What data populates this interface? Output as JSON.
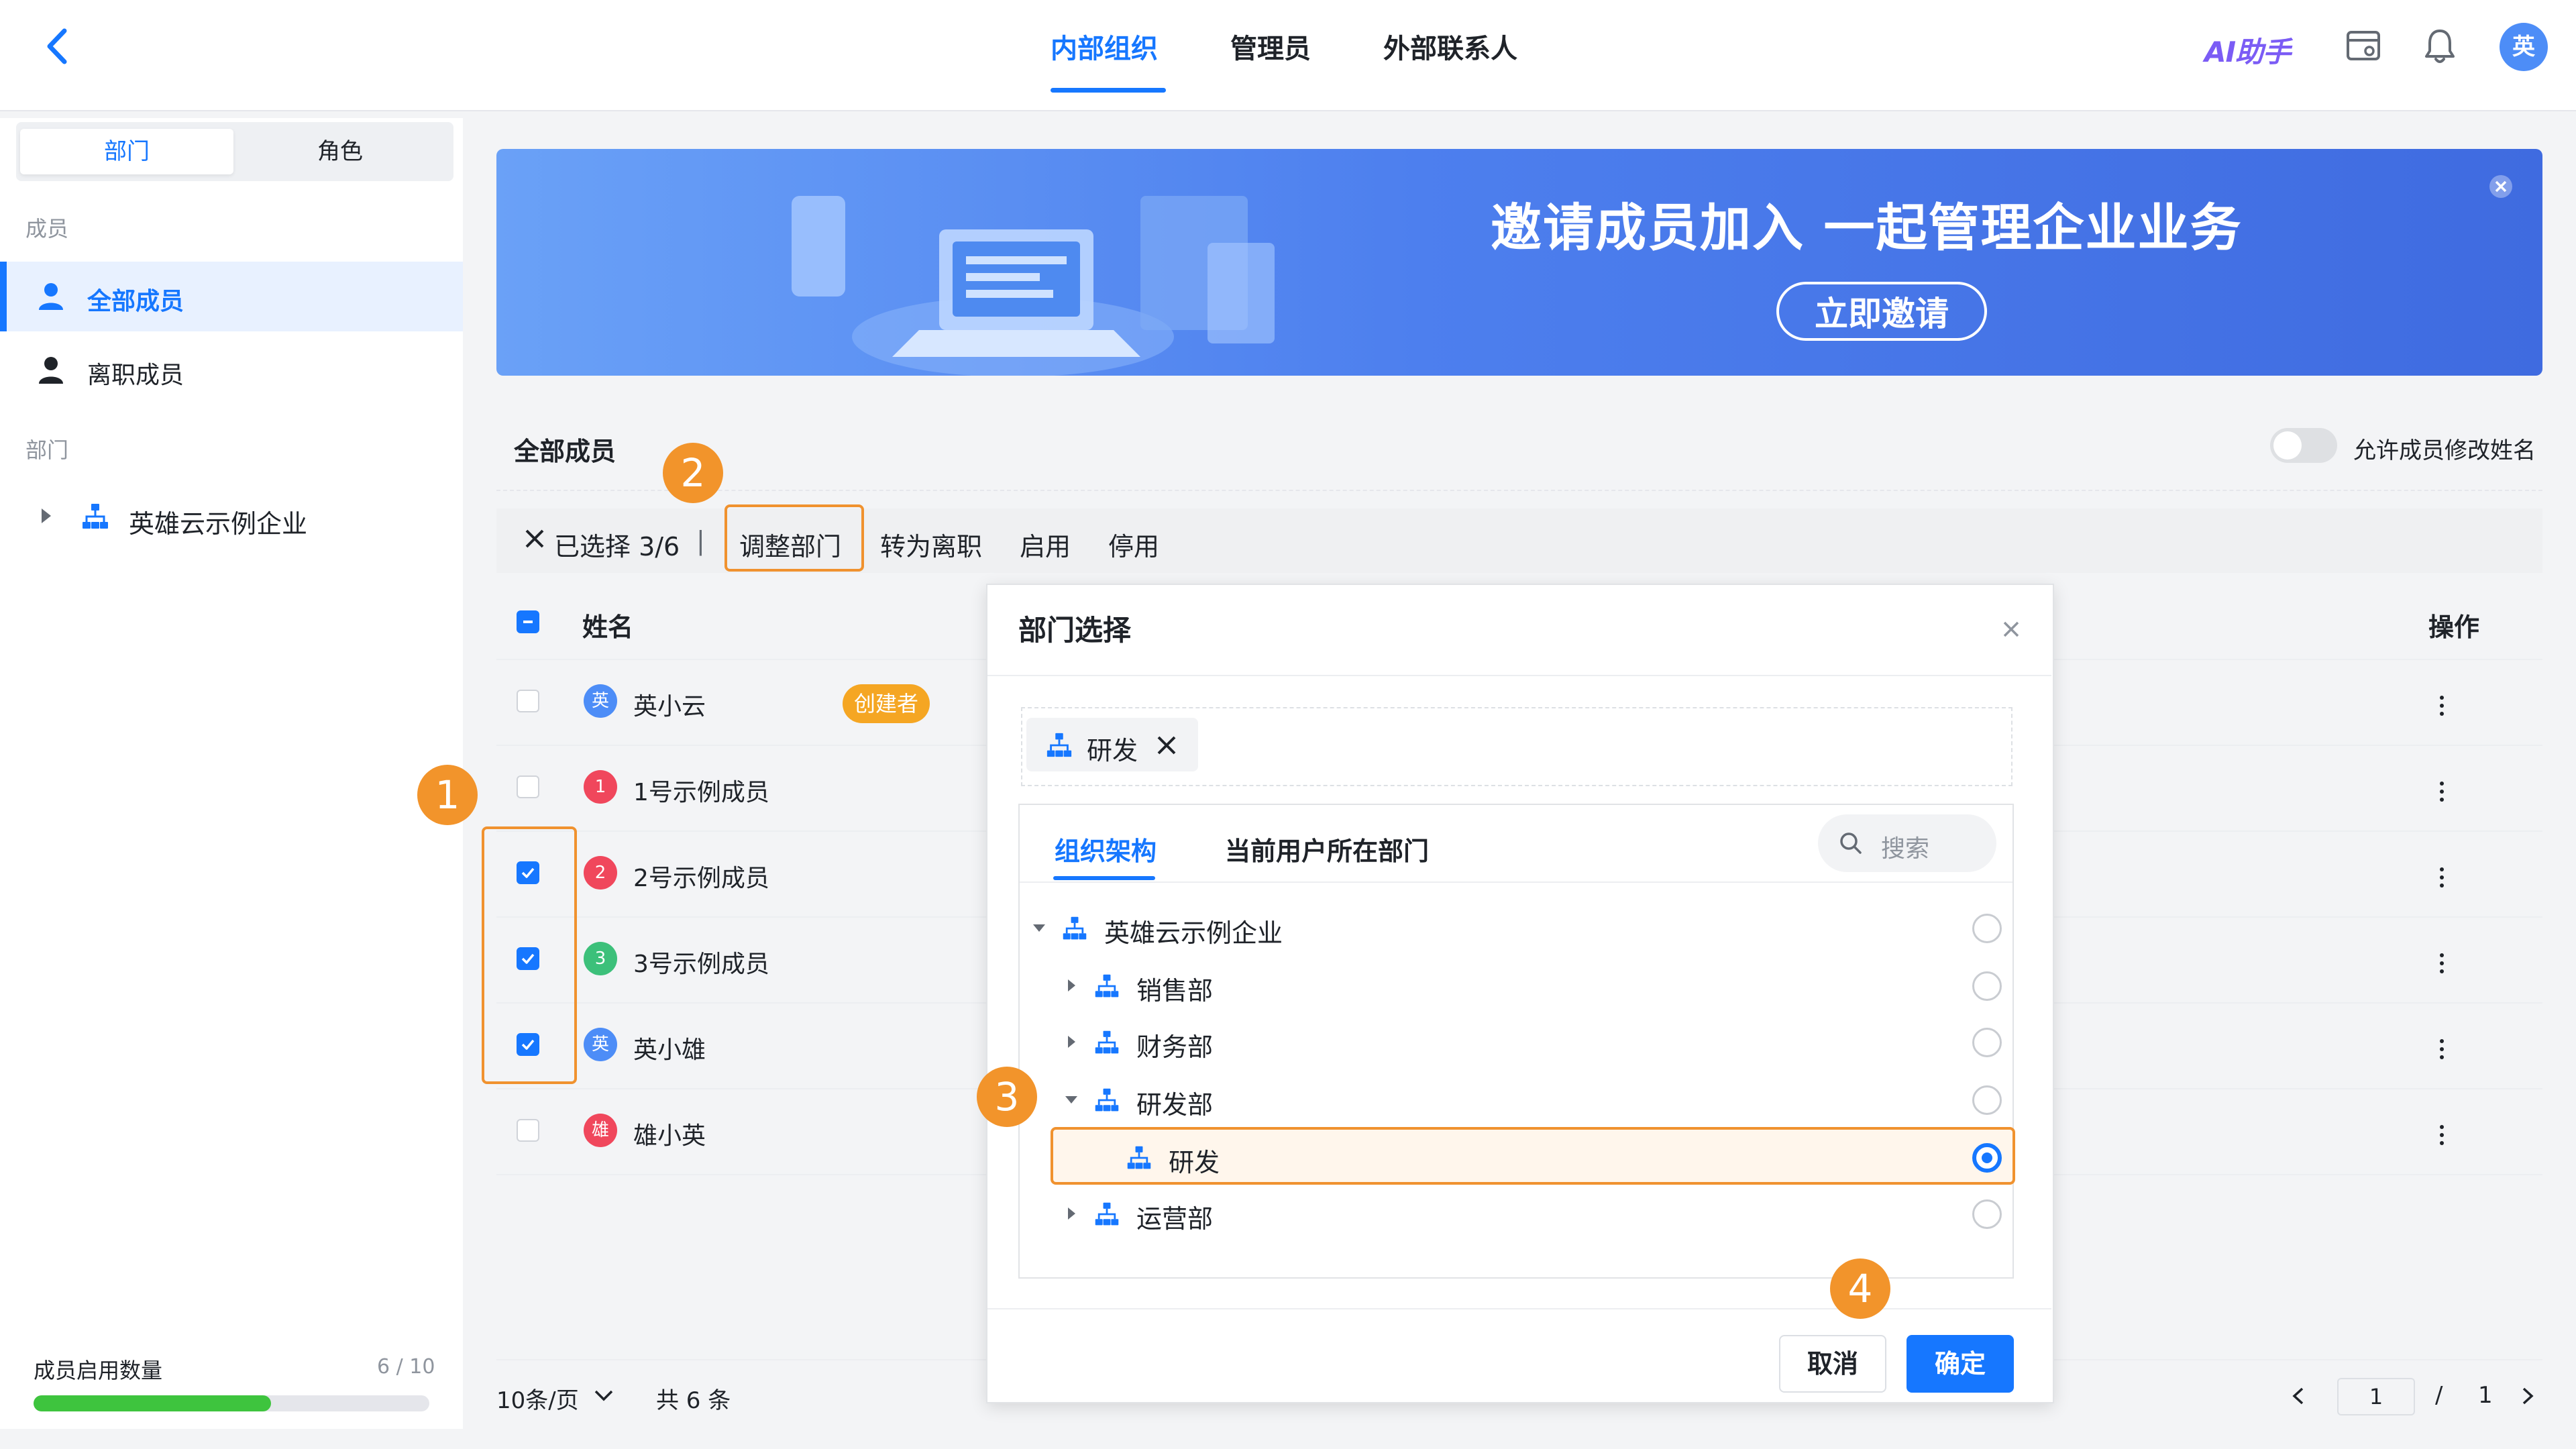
{
  "header": {
    "tabs": [
      {
        "label": "内部组织",
        "active": true
      },
      {
        "label": "管理员",
        "active": false
      },
      {
        "label": "外部联系人",
        "active": false
      }
    ],
    "ai_label": "AI助手",
    "avatar_text": "英",
    "icons": [
      "back-icon",
      "console-icon",
      "bell-icon"
    ]
  },
  "sidebar": {
    "segments": [
      {
        "label": "部门",
        "active": true
      },
      {
        "label": "角色",
        "active": false
      }
    ],
    "members_section": "成员",
    "items": [
      {
        "label": "全部成员",
        "active": true,
        "icon": "user-icon"
      },
      {
        "label": "离职成员",
        "active": false,
        "icon": "user-icon"
      }
    ],
    "dept_section": "部门",
    "dept_root": "英雄云示例企业",
    "quota_label": "成员启用数量",
    "quota_value": "6 / 10",
    "quota_fraction": 0.6
  },
  "banner": {
    "title": "邀请成员加入 一起管理企业业务",
    "button": "立即邀请"
  },
  "main": {
    "title": "全部成员",
    "toggle_label": "允许成员修改姓名",
    "toggle_on": false,
    "actions": {
      "selected": "已选择 3/6",
      "divider": "|",
      "adjust": "调整部门",
      "resign": "转为离职",
      "enable": "启用",
      "disable": "停用"
    },
    "columns": {
      "name": "姓名",
      "ops": "操作"
    },
    "creator_badge": "创建者",
    "rows": [
      {
        "avatar": "英",
        "avatar_color": "#4d8df7",
        "name": "英小云",
        "checked": false
      },
      {
        "avatar": "1",
        "avatar_color": "#f0475c",
        "name": "1号示例成员",
        "checked": false
      },
      {
        "avatar": "2",
        "avatar_color": "#f0475c",
        "name": "2号示例成员",
        "checked": true
      },
      {
        "avatar": "3",
        "avatar_color": "#3cc07a",
        "name": "3号示例成员",
        "checked": true
      },
      {
        "avatar": "英",
        "avatar_color": "#4d8df7",
        "name": "英小雄",
        "checked": true
      },
      {
        "avatar": "雄",
        "avatar_color": "#f0475c",
        "name": "雄小英",
        "checked": false
      }
    ],
    "pagination": {
      "page_size": "10条/页",
      "total": "共 6 条",
      "current": "1",
      "slash": "/",
      "pages": "1"
    }
  },
  "steps": [
    "1",
    "2",
    "3",
    "4"
  ],
  "modal": {
    "title": "部门选择",
    "selected_chip": "研发",
    "tabs": [
      {
        "label": "组织架构",
        "active": true
      },
      {
        "label": "当前用户所在部门",
        "active": false
      }
    ],
    "search_placeholder": "搜索",
    "tree": [
      {
        "label": "英雄云示例企业",
        "level": 0,
        "expanded": true,
        "selected": false
      },
      {
        "label": "销售部",
        "level": 1,
        "expanded": false,
        "selected": false
      },
      {
        "label": "财务部",
        "level": 1,
        "expanded": false,
        "selected": false
      },
      {
        "label": "研发部",
        "level": 1,
        "expanded": true,
        "selected": false
      },
      {
        "label": "研发",
        "level": 2,
        "expanded": false,
        "selected": true
      },
      {
        "label": "运营部",
        "level": 1,
        "expanded": false,
        "selected": false
      }
    ],
    "cancel": "取消",
    "confirm": "确定"
  },
  "colors": {
    "primary": "#1677ff",
    "highlight": "#f0922f",
    "quota_fill": "#3ec43e"
  }
}
